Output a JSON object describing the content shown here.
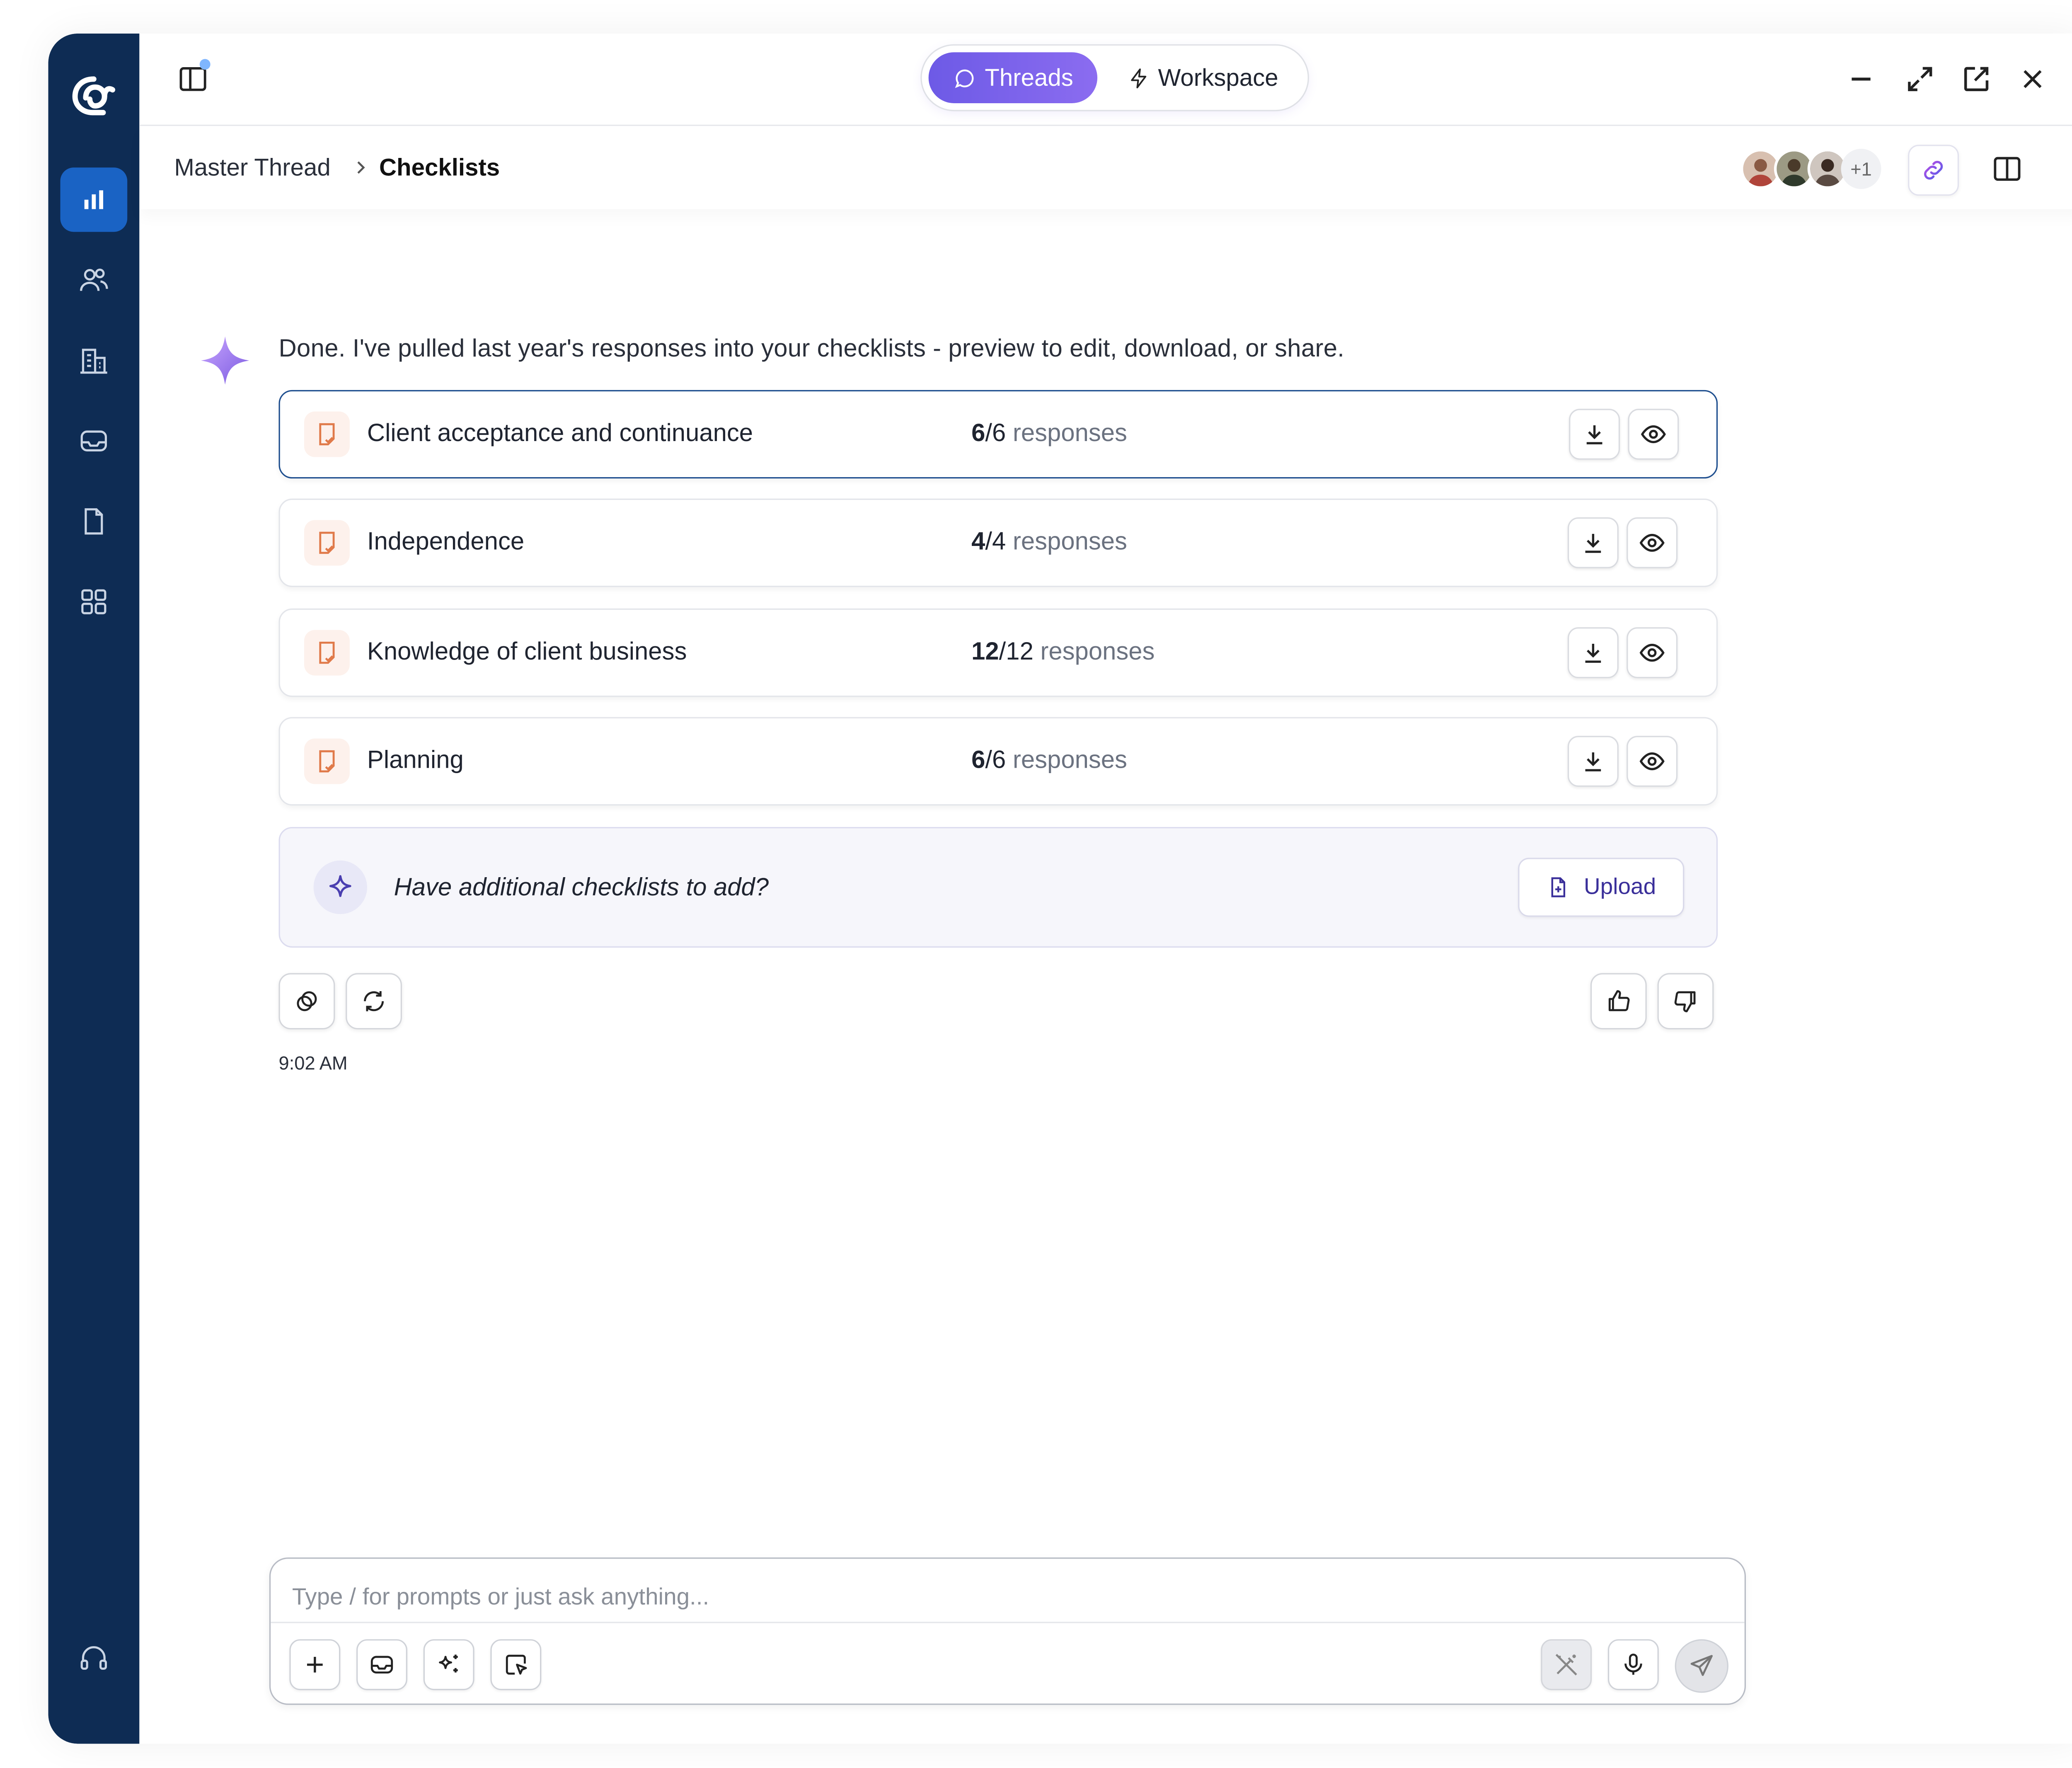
{
  "header": {
    "tabs": [
      {
        "label": "Threads",
        "active": true
      },
      {
        "label": "Workspace",
        "active": false
      }
    ],
    "window_controls": [
      "minimize-icon",
      "expand-icon",
      "open-external-icon",
      "close-icon"
    ]
  },
  "breadcrumb": {
    "parent": "Master Thread",
    "current": "Checklists"
  },
  "collaborators": {
    "extra_count": "+1"
  },
  "sidebar": {
    "items": [
      {
        "icon": "bar-chart-icon",
        "active": true
      },
      {
        "icon": "users-icon",
        "active": false
      },
      {
        "icon": "building-icon",
        "active": false
      },
      {
        "icon": "inbox-icon",
        "active": false
      },
      {
        "icon": "document-icon",
        "active": false
      },
      {
        "icon": "apps-grid-icon",
        "active": false
      }
    ],
    "bottom_icon": "headset-icon"
  },
  "message": {
    "text": "Done. I've pulled last year's responses into your checklists - preview to edit, download, or share.",
    "time": "9:02 AM"
  },
  "checklists": [
    {
      "name": "Client acceptance and continuance",
      "done": "6",
      "total": "/6",
      "suffix": " responses"
    },
    {
      "name": "Independence",
      "done": "4",
      "total": "/4",
      "suffix": " responses"
    },
    {
      "name": "Knowledge of client business",
      "done": "12",
      "total": "/12",
      "suffix": " responses"
    },
    {
      "name": "Planning",
      "done": "6",
      "total": "/6",
      "suffix": " responses"
    }
  ],
  "add_prompt": {
    "text": "Have additional checklists to add?",
    "button": "Upload"
  },
  "composer": {
    "placeholder": "Type / for prompts or just ask anything..."
  },
  "colors": {
    "sidebar": "#0e2c54",
    "sidebar_active": "#1a63c4",
    "accent_purple": "#6d5ae6",
    "selected_border": "#1f4f8f",
    "doc_icon": "#e07a4a"
  }
}
